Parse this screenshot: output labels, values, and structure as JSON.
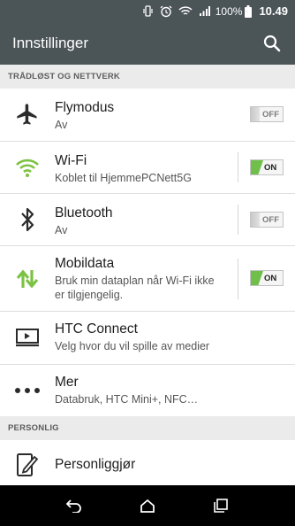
{
  "status_bar": {
    "battery": "100%",
    "time": "10.49",
    "icons": [
      "vibrate-icon",
      "alarm-icon",
      "wifi-calling-icon",
      "signal-icon",
      "battery-icon"
    ]
  },
  "header": {
    "title": "Innstillinger",
    "search_icon": "search-icon"
  },
  "sections": {
    "wireless": {
      "label": "TRÅDLØST OG NETTVERK"
    },
    "personal": {
      "label": "PERSONLIG"
    }
  },
  "rows": {
    "flymodus": {
      "title": "Flymodus",
      "subtitle": "Av",
      "icon": "airplane-icon",
      "toggle": "OFF"
    },
    "wifi": {
      "title": "Wi-Fi",
      "subtitle": "Koblet til HjemmePCNett5G",
      "icon": "wifi-icon",
      "toggle": "ON",
      "icon_color": "#7cc242"
    },
    "bluetooth": {
      "title": "Bluetooth",
      "subtitle": "Av",
      "icon": "bluetooth-icon",
      "toggle": "OFF"
    },
    "mobildata": {
      "title": "Mobildata",
      "subtitle_line1": "Bruk min dataplan når Wi-Fi ikke",
      "subtitle_line2": "er tilgjengelig.",
      "icon": "mobile-data-icon",
      "toggle": "ON",
      "icon_color": "#7cc242"
    },
    "htc_connect": {
      "title": "HTC Connect",
      "subtitle": "Velg hvor du vil spille av medier",
      "icon": "htc-connect-icon"
    },
    "mer": {
      "title": "Mer",
      "subtitle": "Databruk, HTC Mini+, NFC…",
      "icon": "more-icon"
    },
    "personliggjor": {
      "title": "Personliggjør",
      "icon": "personalize-icon"
    }
  },
  "navigation": {
    "back": "back-icon",
    "home": "home-icon",
    "recents": "recents-icon"
  },
  "colors": {
    "app_bar": "#4b5457",
    "accent_green": "#7cc242",
    "section_bg": "#ebebeb"
  }
}
